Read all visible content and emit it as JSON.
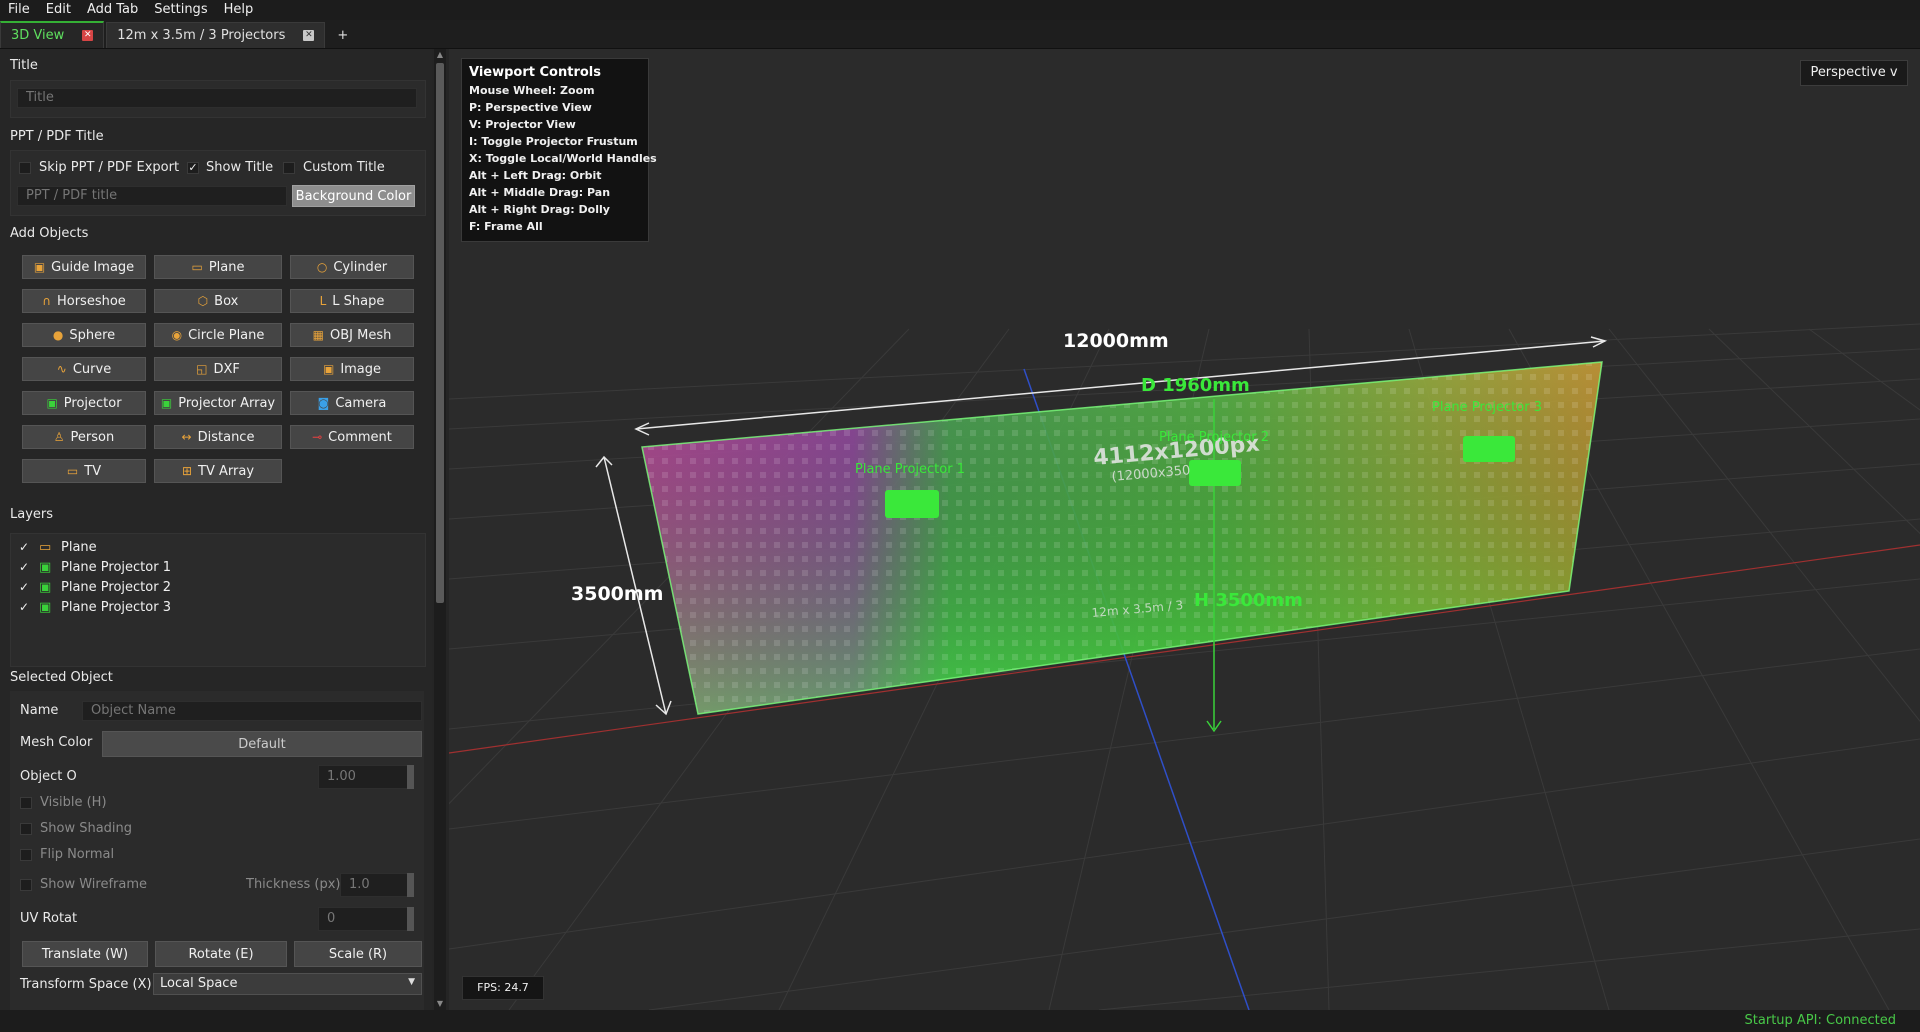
{
  "menu": [
    "File",
    "Edit",
    "Add Tab",
    "Settings",
    "Help"
  ],
  "tabs": [
    {
      "label": "3D View",
      "active": true
    },
    {
      "label": "12m x 3.5m / 3 Projectors",
      "active": false
    }
  ],
  "add_tab_label": "+",
  "panel": {
    "title_section": {
      "heading": "Title",
      "placeholder": "Title"
    },
    "pdf_section": {
      "heading": "PPT / PDF Title",
      "skip_label": "Skip PPT / PDF Export",
      "show_title_label": "Show Title",
      "custom_title_label": "Custom Title",
      "placeholder": "PPT / PDF title",
      "bg_button": "Background Color"
    },
    "add_objects": {
      "heading": "Add Objects",
      "buttons": [
        {
          "label": "Guide Image",
          "icon": "image-icon"
        },
        {
          "label": "Plane",
          "icon": "plane-icon"
        },
        {
          "label": "Cylinder",
          "icon": "cylinder-icon"
        },
        {
          "label": "Horseshoe",
          "icon": "horseshoe-icon"
        },
        {
          "label": "Box",
          "icon": "box-icon"
        },
        {
          "label": "L Shape",
          "icon": "l-shape-icon"
        },
        {
          "label": "Sphere",
          "icon": "sphere-icon"
        },
        {
          "label": "Circle Plane",
          "icon": "circle-plane-icon"
        },
        {
          "label": "OBJ Mesh",
          "icon": "mesh-icon"
        },
        {
          "label": "Curve",
          "icon": "curve-icon"
        },
        {
          "label": "DXF",
          "icon": "dxf-icon"
        },
        {
          "label": "Image",
          "icon": "image-icon"
        },
        {
          "label": "Projector",
          "icon": "projector-icon"
        },
        {
          "label": "Projector Array",
          "icon": "projector-array-icon"
        },
        {
          "label": "Camera",
          "icon": "camera-icon"
        },
        {
          "label": "Person",
          "icon": "person-icon"
        },
        {
          "label": "Distance",
          "icon": "distance-icon"
        },
        {
          "label": "Comment",
          "icon": "comment-icon"
        },
        {
          "label": "TV",
          "icon": "tv-icon"
        },
        {
          "label": "TV Array",
          "icon": "tv-array-icon"
        }
      ]
    },
    "layers": {
      "heading": "Layers",
      "items": [
        {
          "label": "Plane",
          "checked": true,
          "icon": "plane-icon"
        },
        {
          "label": "Plane Projector 1",
          "checked": true,
          "icon": "projector-icon"
        },
        {
          "label": "Plane Projector 2",
          "checked": true,
          "icon": "projector-icon"
        },
        {
          "label": "Plane Projector 3",
          "checked": true,
          "icon": "projector-icon"
        }
      ]
    },
    "selected": {
      "heading": "Selected Object",
      "name_label": "Name",
      "name_placeholder": "Object Name",
      "mesh_color_label": "Mesh Color",
      "mesh_color_value": "Default",
      "opacity_label": "Object O",
      "opacity_value": "1.00",
      "visible_label": "Visible (H)",
      "shading_label": "Show Shading",
      "flip_label": "Flip Normal",
      "wireframe_label": "Show Wireframe",
      "thickness_label": "Thickness (px)",
      "thickness_value": "1.0",
      "uv_label": "UV Rotat",
      "uv_value": "0",
      "translate": "Translate (W)",
      "rotate": "Rotate (E)",
      "scale": "Scale (R)",
      "transform_space_label": "Transform Space (X)",
      "transform_space_value": "Local Space"
    }
  },
  "viewport": {
    "controls_title": "Viewport Controls",
    "controls": [
      "Mouse Wheel: Zoom",
      "P: Perspective View",
      "V: Projector View",
      "I: Toggle Projector Frustum",
      "X: Toggle Local/World Handles",
      "Alt + Left Drag: Orbit",
      "Alt + Middle Drag: Pan",
      "Alt + Right Drag: Dolly",
      "F: Frame All"
    ],
    "view_mode": "Perspective v",
    "fps": "FPS: 24.7",
    "width_label": "12000mm",
    "height_label": "3500mm",
    "depth_label": "D 1960mm",
    "h_label": "H 3500mm",
    "resolution": "4112x1200px",
    "resolution_sub": "(12000x350",
    "plane_text": "12m x 3.5m / 3",
    "projectors": [
      "Plane Projector 1",
      "Plane Projector 2",
      "Plane Projector 3"
    ]
  },
  "status": "Startup API: Connected",
  "colors": {
    "accent": "#3ad23a",
    "status": "#48c848",
    "active_tab_close": "#d64545"
  }
}
